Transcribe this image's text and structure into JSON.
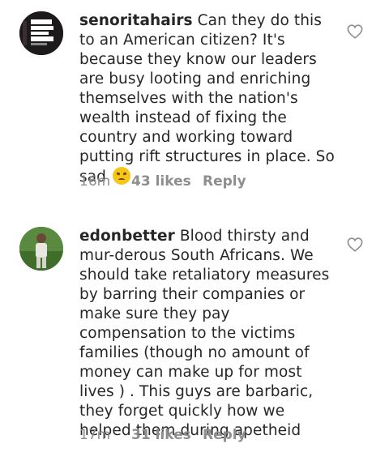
{
  "comments": [
    {
      "username": "senoritahairs",
      "text": "Can they do this to an American citizen? It's because they know our leaders are busy looting and enriching themselves with the nation's wealth instead of fixing the country and working toward putting rift structures in place. So sad",
      "emoji": "sad-face-emoji",
      "time": "16m",
      "likes": "43 likes",
      "reply_label": "Reply",
      "avatar_lines": [
        "CLOSURE",
        "500 FRONTALS",
        "TRENDING",
        "FREE WIGGING"
      ]
    },
    {
      "username": "edonbetter",
      "text": "Blood thirsty and mur-derous South Africans. We should take retaliatory measures by barring their companies or make sure they pay compensation to the victims families (though no amount of money can make up for most lives ) . This guys are barbaric, they forget quickly how we helped them during apetheid",
      "time": "17m",
      "likes": "31 likes",
      "reply_label": "Reply"
    }
  ],
  "colors": {
    "text": "#262626",
    "meta": "#8e8e8e",
    "emoji": "#f5c518"
  }
}
